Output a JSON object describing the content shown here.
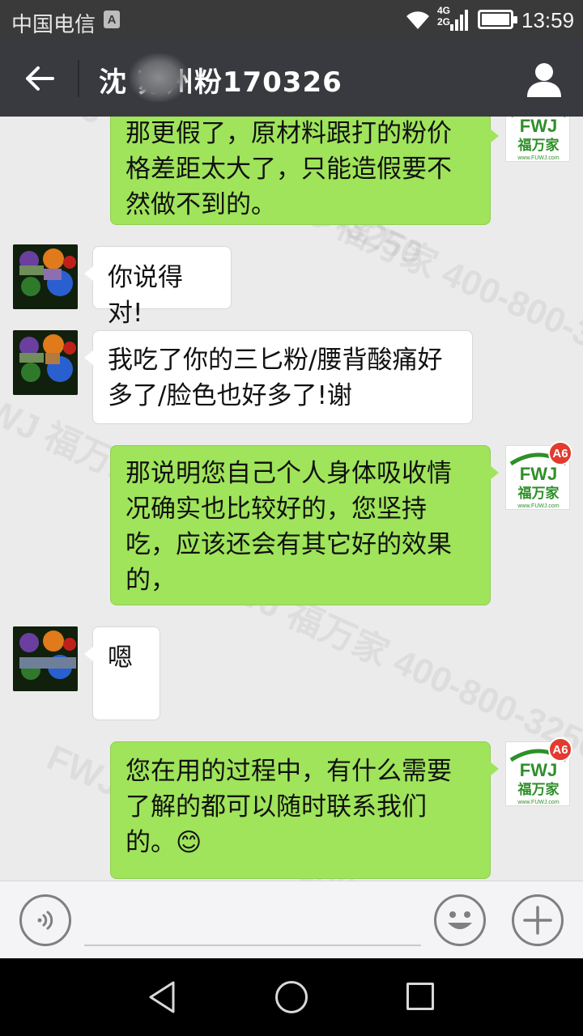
{
  "status_bar": {
    "carrier": "中国电信",
    "sim_badge": "A",
    "network_top": "4G",
    "network_bottom": "2G",
    "time": "13:59"
  },
  "header": {
    "title": "沈 苏州粉170326",
    "back_icon": "arrow-left-icon",
    "profile_icon": "person-icon"
  },
  "watermark_text": "FWJ 福万家 400-800-3250",
  "messages": [
    {
      "side": "out",
      "lines": [
        "那更假了，原材料跟打的粉价",
        "格差距太大了，只能造假要不",
        "然做不到的。"
      ]
    },
    {
      "side": "in",
      "lines": [
        "你说得对!"
      ]
    },
    {
      "side": "in",
      "lines": [
        "我吃了你的三匕粉/腰背酸痛好",
        "多了/脸色也好多了!谢"
      ]
    },
    {
      "side": "out",
      "lines": [
        "那说明您自己个人身体吸收情",
        "况确实也比较好的，您坚持",
        "吃，应该还会有其它好的效果",
        "的，"
      ]
    },
    {
      "side": "in",
      "lines": [
        "",
        "嗯"
      ]
    },
    {
      "side": "out",
      "lines": [
        "您在用的过程中，有什么需要",
        "了解的都可以随时联系我们",
        "的。😊"
      ]
    }
  ],
  "avatar_out": {
    "logo_text": "FWJ",
    "brand": "福万家",
    "url": "www.FUWJ.com",
    "badge": "A6"
  },
  "colors": {
    "bubble_out": "#9fe45a",
    "bubble_in": "#ffffff",
    "titlebar": "#393a3f",
    "chat_bg": "#ebebeb",
    "brand_green": "#2f8f2a",
    "badge_red": "#e23b2f"
  },
  "input_bar": {
    "voice_icon": "voice-icon",
    "emoji_icon": "emoji-icon",
    "plus_icon": "plus-icon"
  },
  "nav_bar": {
    "back_icon": "triangle-back-icon",
    "home_icon": "circle-home-icon",
    "recent_icon": "square-recent-icon"
  }
}
